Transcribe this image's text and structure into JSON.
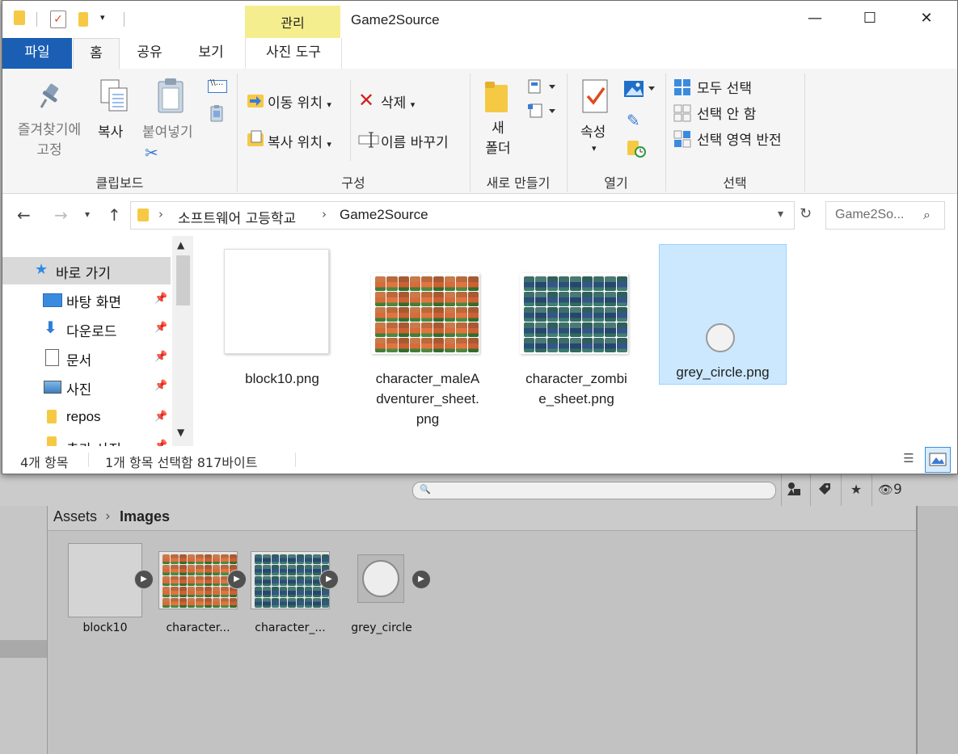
{
  "window": {
    "title": "Game2Source",
    "context_tab_group": "관리",
    "controls": {
      "minimize": "—",
      "maximize": "☐",
      "close": "✕"
    }
  },
  "quick_access": {
    "dropdown": "▾"
  },
  "tabs": {
    "file": "파일",
    "home": "홈",
    "share": "공유",
    "view": "보기",
    "picture_tools": "사진 도구"
  },
  "ribbon": {
    "clipboard": {
      "label": "클립보드",
      "pin": "즐겨찾기에\n고정",
      "pin_line1": "즐겨찾기에",
      "pin_line2": "고정",
      "copy": "복사",
      "paste": "붙여넣기"
    },
    "organize": {
      "label": "구성",
      "move_to": "이동 위치",
      "copy_to": "복사 위치",
      "delete": "삭제",
      "rename": "이름 바꾸기"
    },
    "new": {
      "label": "새로 만들기",
      "new_folder_line1": "새",
      "new_folder_line2": "폴더"
    },
    "open": {
      "label": "열기",
      "properties": "속성"
    },
    "select": {
      "label": "선택",
      "select_all": "모두 선택",
      "select_none": "선택 안 함",
      "invert": "선택 영역 반전"
    }
  },
  "address": {
    "crumbs": [
      "소프트웨어 고등학교",
      "Game2Source"
    ],
    "search_placeholder": "Game2So..."
  },
  "nav": {
    "items": [
      {
        "label": "바로 가기",
        "icon": "star-icon"
      },
      {
        "label": "바탕 화면",
        "icon": "desktop-icon"
      },
      {
        "label": "다운로드",
        "icon": "download-icon"
      },
      {
        "label": "문서",
        "icon": "document-icon"
      },
      {
        "label": "사진",
        "icon": "picture-icon"
      },
      {
        "label": "repos",
        "icon": "folder-icon"
      },
      {
        "label": "추가 사진",
        "icon": "folder-icon"
      }
    ]
  },
  "files": [
    {
      "name": "block10.png",
      "selected": false
    },
    {
      "name": "character_maleAdventurer_sheet.png",
      "line1": "character_maleA",
      "line2": "dventurer_sheet.",
      "line3": "png",
      "selected": false
    },
    {
      "name": "character_zombie_sheet.png",
      "line1": "character_zombi",
      "line2": "e_sheet.png",
      "selected": false
    },
    {
      "name": "grey_circle.png",
      "selected": true
    }
  ],
  "status": {
    "count": "4개 항목",
    "selection": "1개 항목 선택함 817바이트"
  },
  "unity": {
    "breadcrumb": {
      "root": "Assets",
      "current": "Images"
    },
    "hidden_count": "9",
    "assets": [
      {
        "label": "block10"
      },
      {
        "label": "character..."
      },
      {
        "label": "character_..."
      },
      {
        "label": "grey_circle"
      }
    ]
  },
  "colors": {
    "accent": "#1a5fb4",
    "context_tab": "#f5ee8e",
    "selection": "#cce8ff",
    "unity_bg": "#c2c2c2"
  }
}
